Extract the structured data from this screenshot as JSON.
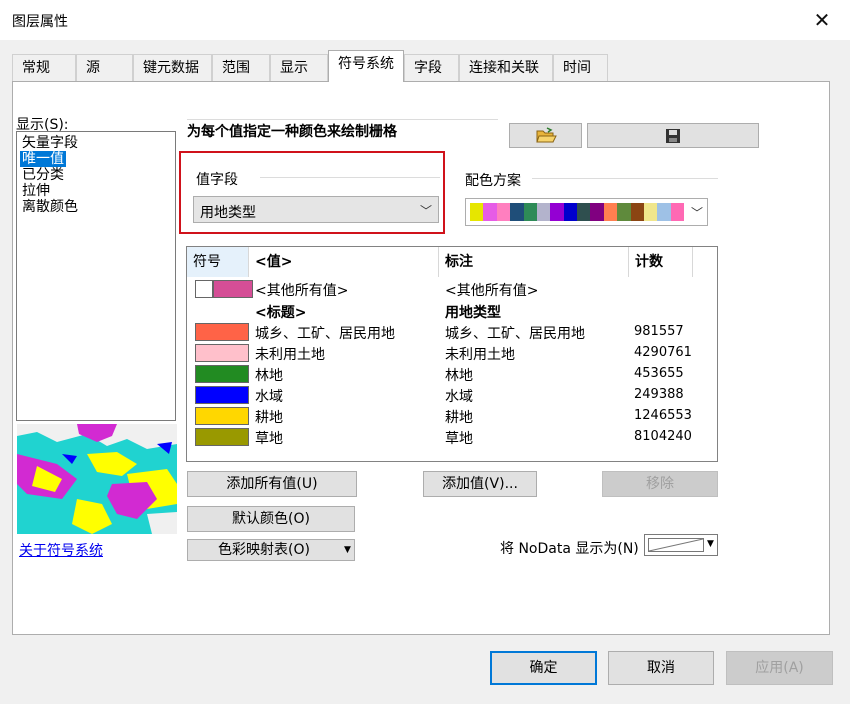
{
  "window": {
    "title": "图层属性",
    "close_glyph": "✕"
  },
  "tabs": [
    "常规",
    "源",
    "键元数据",
    "范围",
    "显示",
    "符号系统",
    "字段",
    "连接和关联",
    "时间"
  ],
  "active_tab": "符号系统",
  "show": {
    "label": "显示(S):",
    "items": [
      "矢量字段",
      "唯一值",
      "已分类",
      "拉伸",
      "离散颜色"
    ],
    "selected": "唯一值"
  },
  "about_link": "关于符号系统",
  "heading": "为每个值指定一种颜色来绘制栅格",
  "value_field": {
    "label": "值字段",
    "value": "用地类型"
  },
  "color_scheme": {
    "label": "配色方案",
    "colors": [
      "#e6e600",
      "#e65ce6",
      "#ff7fbf",
      "#1f4e79",
      "#2e8b57",
      "#b3b3cc",
      "#9400d3",
      "#0000cd",
      "#2f4f4f",
      "#800080",
      "#ff7f50",
      "#5f8a3c",
      "#8b4513",
      "#f0e68c",
      "#9ec1e6",
      "#ff69b4"
    ]
  },
  "table": {
    "headers": {
      "symbol": "符号",
      "value": "<值>",
      "label": "标注",
      "count": "计数"
    },
    "other": {
      "value": "<其他所有值>",
      "label": "<其他所有值>",
      "color": "#d54e96"
    },
    "heading_row": {
      "value": "<标题>",
      "label": "用地类型"
    },
    "rows": [
      {
        "color": "#ff6347",
        "value": "城乡、工矿、居民用地",
        "label": "城乡、工矿、居民用地",
        "count": "981557"
      },
      {
        "color": "#ffc0cb",
        "value": "未利用土地",
        "label": "未利用土地",
        "count": "4290761"
      },
      {
        "color": "#228b22",
        "value": "林地",
        "label": "林地",
        "count": "453655"
      },
      {
        "color": "#0000ff",
        "value": "水域",
        "label": "水域",
        "count": "249388"
      },
      {
        "color": "#ffd700",
        "value": "耕地",
        "label": "耕地",
        "count": "1246553"
      },
      {
        "color": "#999900",
        "value": "草地",
        "label": "草地",
        "count": "8104240"
      }
    ]
  },
  "buttons": {
    "add_all": "添加所有值(U)",
    "add_values": "添加值(V)...",
    "remove": "移除",
    "default_colors": "默认颜色(O)",
    "colormap": "色彩映射表(O)",
    "nodata_label": "将 NoData 显示为(N)",
    "ok": "确定",
    "cancel": "取消",
    "apply": "应用(A)"
  }
}
